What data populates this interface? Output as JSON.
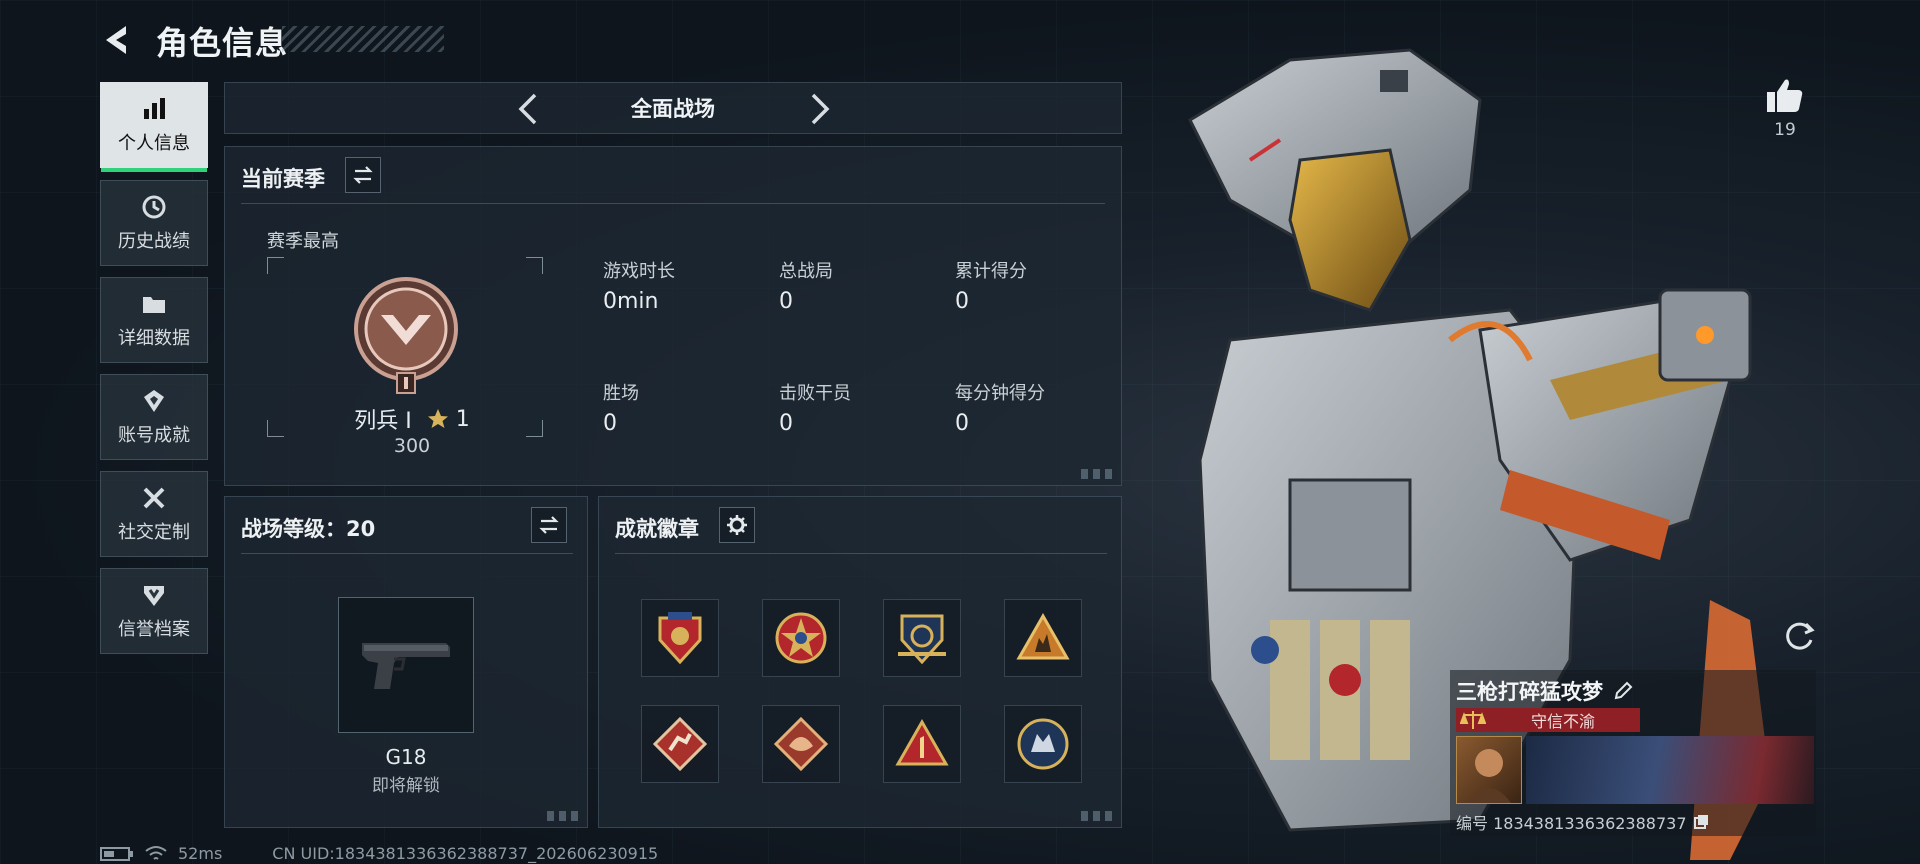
{
  "header": {
    "title": "角色信息"
  },
  "sidebar": {
    "items": [
      {
        "label": "个人信息",
        "icon": "bar-chart-icon",
        "active": true
      },
      {
        "label": "历史战绩",
        "icon": "history-clock-icon"
      },
      {
        "label": "详细数据",
        "icon": "folder-icon"
      },
      {
        "label": "账号成就",
        "icon": "achievement-icon"
      },
      {
        "label": "社交定制",
        "icon": "tools-icon"
      },
      {
        "label": "信誉档案",
        "icon": "shield-badge-icon"
      }
    ]
  },
  "mode_tab": {
    "title": "全面战场"
  },
  "season": {
    "title": "当前赛季",
    "best_label": "赛季最高",
    "rank_name": "列兵 I",
    "rank_stars": "1",
    "rank_points": "300",
    "stats": [
      {
        "label": "游戏时长",
        "value": "0min"
      },
      {
        "label": "总战局",
        "value": "0"
      },
      {
        "label": "累计得分",
        "value": "0"
      },
      {
        "label": "胜场",
        "value": "0"
      },
      {
        "label": "击败干员",
        "value": "0"
      },
      {
        "label": "每分钟得分",
        "value": "0"
      }
    ]
  },
  "battlefield_level": {
    "title": "战场等级：20",
    "weapon_name": "G18",
    "weapon_status": "即将解锁"
  },
  "achievements": {
    "title": "成就徽章",
    "badges": [
      "badge-eagle-shield",
      "badge-star-crest",
      "badge-wings-shield",
      "badge-triangle-soldiers",
      "badge-runner-diamond",
      "badge-dragon-diamond",
      "badge-number-one",
      "badge-wolf-circle"
    ]
  },
  "likes": {
    "count": "19"
  },
  "profile_card": {
    "name": "三枪打碎猛攻梦",
    "title_badge": "守信不渝",
    "id_text": "编号 1834381336362388737"
  },
  "status_bar": {
    "ping": "52ms",
    "uid": "CN UID:1834381336362388737_202606230915"
  },
  "colors": {
    "accent_green": "#2fd27a",
    "title_red": "#8e1f24"
  }
}
